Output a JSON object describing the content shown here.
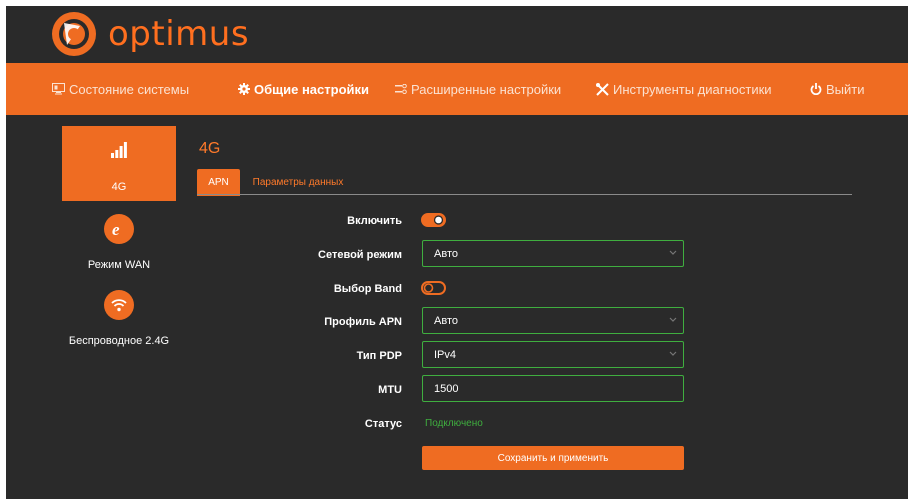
{
  "brand": {
    "name": "optimus",
    "accent": "#ef6c22",
    "success": "#3fae3f"
  },
  "nav": {
    "items": [
      {
        "label": "Состояние системы",
        "icon": "monitor-icon"
      },
      {
        "label": "Общие настройки",
        "icon": "gear-icon",
        "active": true
      },
      {
        "label": "Расширенные настройки",
        "icon": "sliders-icon"
      },
      {
        "label": "Инструменты диагностики",
        "icon": "tools-icon"
      },
      {
        "label": "Выйти",
        "icon": "power-icon"
      }
    ]
  },
  "sidebar": {
    "items": [
      {
        "label": "4G",
        "icon": "signal-bars-icon",
        "active": true
      },
      {
        "label": "Режим WAN",
        "icon": "internet-explorer-icon"
      },
      {
        "label": "Беспроводное 2.4G",
        "icon": "wifi-icon"
      }
    ]
  },
  "main": {
    "title": "4G",
    "tabs": [
      {
        "label": "APN",
        "active": true
      },
      {
        "label": "Параметры данных",
        "active": false
      }
    ],
    "form": {
      "enable": {
        "label": "Включить",
        "on": true
      },
      "network_mode": {
        "label": "Сетевой режим",
        "value": "Авто"
      },
      "band_select": {
        "label": "Выбор Band",
        "on": false
      },
      "apn_profile": {
        "label": "Профиль APN",
        "value": "Авто"
      },
      "pdp_type": {
        "label": "Тип PDP",
        "value": "IPv4"
      },
      "mtu": {
        "label": "MTU",
        "value": "1500"
      },
      "status": {
        "label": "Статус",
        "value": "Подключено"
      }
    },
    "save_label": "Сохранить и применить"
  }
}
